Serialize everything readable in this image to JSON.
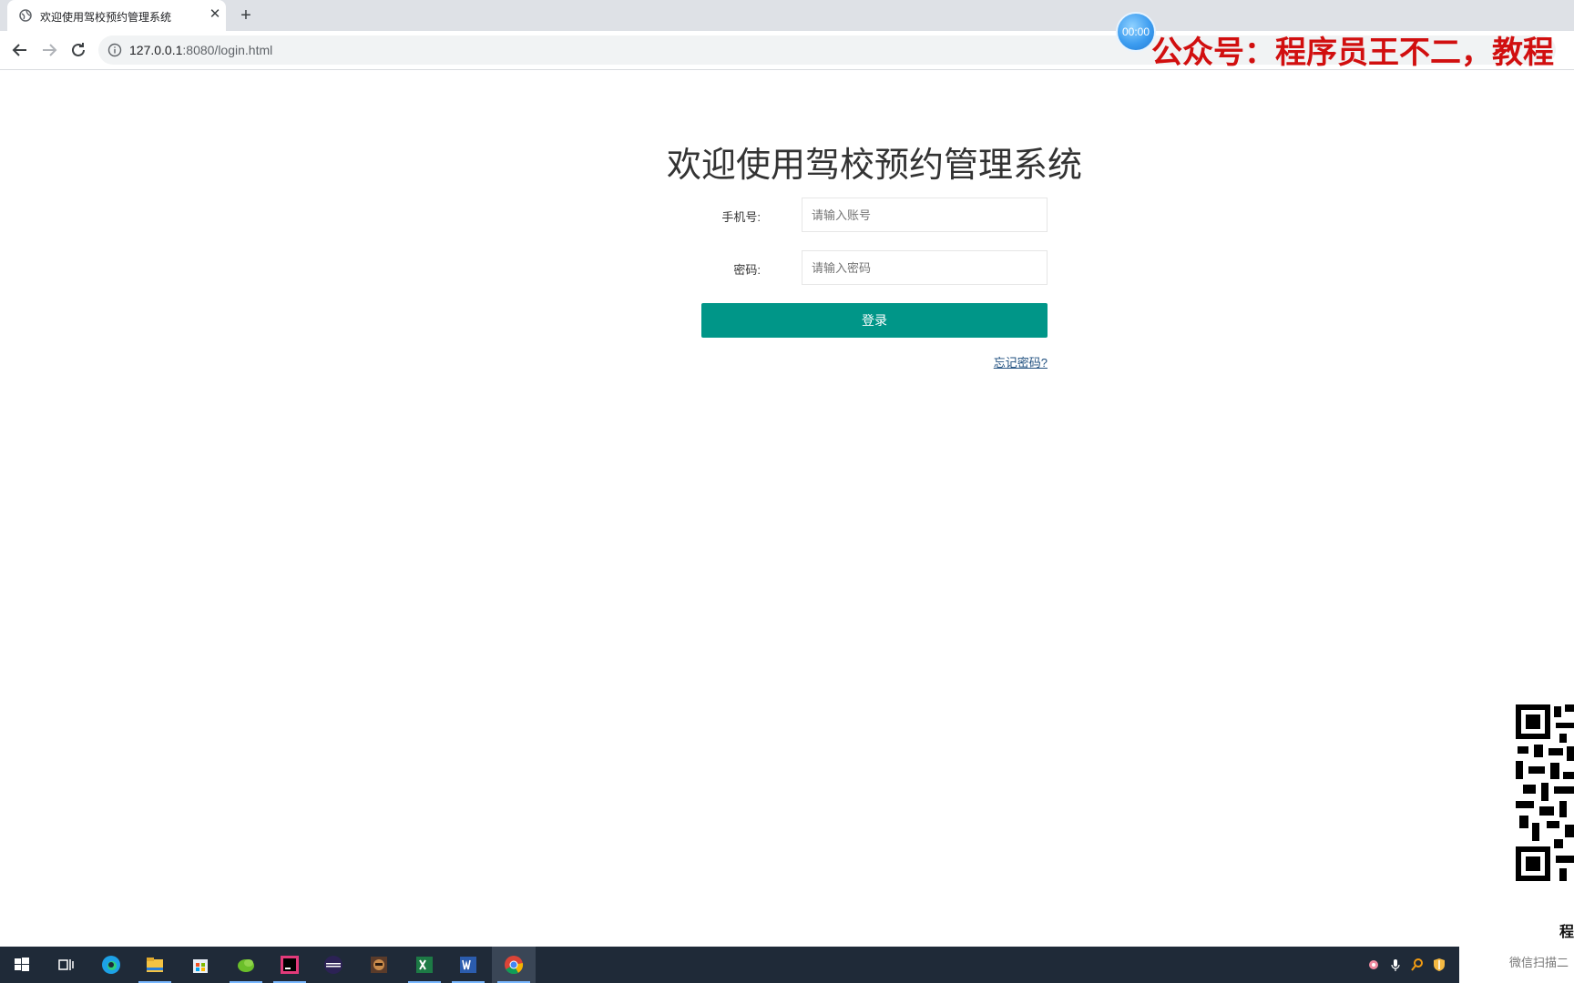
{
  "browser": {
    "tab_title": "欢迎使用驾校预约管理系统",
    "close_glyph": "✕",
    "new_tab_glyph": "+",
    "url_host": "127.0.0.1",
    "url_rest": ":8080/login.html"
  },
  "overlay": {
    "timer": "00:00",
    "banner": "公众号：程序员王不二，教程",
    "qr_caption": "程",
    "qr_sub": "微信扫描二"
  },
  "login": {
    "title": "欢迎使用驾校预约管理系统",
    "phone_label": "手机号:",
    "phone_placeholder": "请输入账号",
    "password_label": "密码:",
    "password_placeholder": "请输入密码",
    "submit_label": "登录",
    "forgot_label": "忘记密码?"
  },
  "colors": {
    "primary_button": "#009688",
    "banner_text": "#d10f0f",
    "link": "#1e4e7e"
  },
  "taskbar": {
    "icons": [
      "windows-start-icon",
      "task-view-icon",
      "edge-icon",
      "file-explorer-icon",
      "store-icon",
      "leaf-app-icon",
      "intellij-icon",
      "eclipse-icon",
      "game-app-icon",
      "excel-icon",
      "word-icon",
      "chrome-icon"
    ],
    "tray_icons": [
      "flower-tray-icon",
      "microphone-icon",
      "search-tray-icon",
      "security-shield-icon"
    ]
  }
}
